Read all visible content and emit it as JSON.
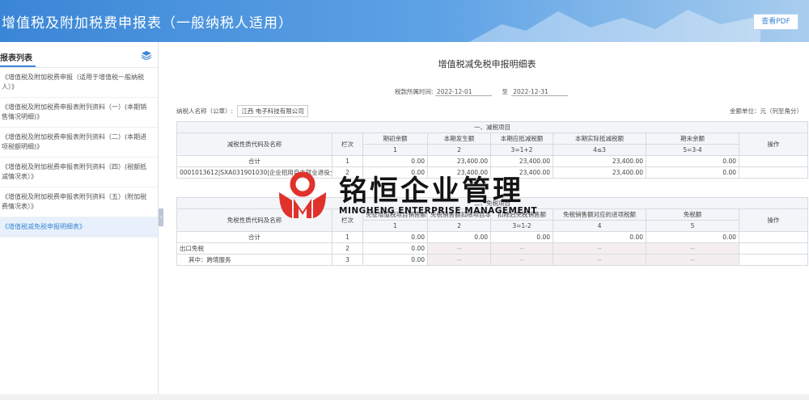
{
  "header": {
    "title": "增值税及附加税费申报表（一般纳税人适用）",
    "pdf_button": "查看PDF"
  },
  "sidebar": {
    "title": "报表列表",
    "items": [
      {
        "label": "《增值税及附加税费申报（适用于增值税一般纳税人）》",
        "active": false
      },
      {
        "label": "《增值税及附加税费申报表附列资料（一）(本期销售情况明细)》",
        "active": false
      },
      {
        "label": "《增值税及附加税费申报表附列资料（二）(本期进项税额明细)》",
        "active": false
      },
      {
        "label": "《增值税及附加税费申报表附列资料（四）(税额抵减情况表）》",
        "active": false
      },
      {
        "label": "《增值税及附加税费申报表附列资料（五）(附加税费情况表）》",
        "active": false
      },
      {
        "label": "《增值税减免税申报明细表》",
        "active": true
      }
    ]
  },
  "report": {
    "title": "增值税减免税申报明细表",
    "period_label": "税款所属时间:",
    "period_start": "2022-12-01",
    "period_sep": "至",
    "period_end": "2022-12-31",
    "taxpayer_label": "纳税人名称（公章）:",
    "taxpayer_name": "江西 电子科技有限公司",
    "unit": "金额单位：元（列至角分）"
  },
  "reduction_table": {
    "section": "一、减税项目",
    "headers": {
      "name": "减税性质代码及名称",
      "row": "栏次",
      "c1": "期初余额",
      "c2": "本期发生额",
      "c3": "本期应抵减税额",
      "c4": "本期实际抵减税额",
      "c5": "期末余额",
      "op": "操作"
    },
    "formulas": [
      "1",
      "2",
      "3=1+2",
      "4≤3",
      "5=3-4"
    ],
    "rows": [
      {
        "name": "合计",
        "no": "1",
        "v1": "0.00",
        "v2": "23,400.00",
        "v3": "23,400.00",
        "v4": "23,400.00",
        "v5": "0.00"
      },
      {
        "name": "0001013612|SXA031901030|企业招用自主就业退役士兵",
        "no": "2",
        "v1": "0.00",
        "v2": "23,400.00",
        "v3": "23,400.00",
        "v4": "23,400.00",
        "v5": "0.00"
      }
    ]
  },
  "exemption_table": {
    "section": "二、免税项目",
    "headers": {
      "name": "免税性质代码及名称",
      "row": "栏次",
      "c1": "免征增值税项目销售额",
      "c2": "免税销售额扣除项目本期实际扣除金额",
      "c3": "扣除后免税销售额",
      "c4": "免税销售额对应的进项税额",
      "c5": "免税额",
      "op": "操作"
    },
    "formulas": [
      "1",
      "2",
      "3=1-2",
      "4",
      "5"
    ],
    "rows": [
      {
        "name": "合计",
        "no": "1",
        "v1": "0.00",
        "v2": "0.00",
        "v3": "0.00",
        "v4": "0.00",
        "v5": "0.00"
      },
      {
        "name": "出口免税",
        "no": "2",
        "v1": "0.00",
        "v2": "--",
        "v3": "--",
        "v4": "--",
        "v5": "--"
      },
      {
        "name": "其中：跨境服务",
        "no": "3",
        "v1": "0.00",
        "v2": "--",
        "v3": "--",
        "v4": "--",
        "v5": "--"
      }
    ]
  },
  "watermark": {
    "cn": "铭恒企业管理",
    "en": "MINGHENG ENTERPRISE MANAGEMENT"
  },
  "colors": {
    "accent": "#3a86d6",
    "watermark_red": "#e0312b"
  }
}
